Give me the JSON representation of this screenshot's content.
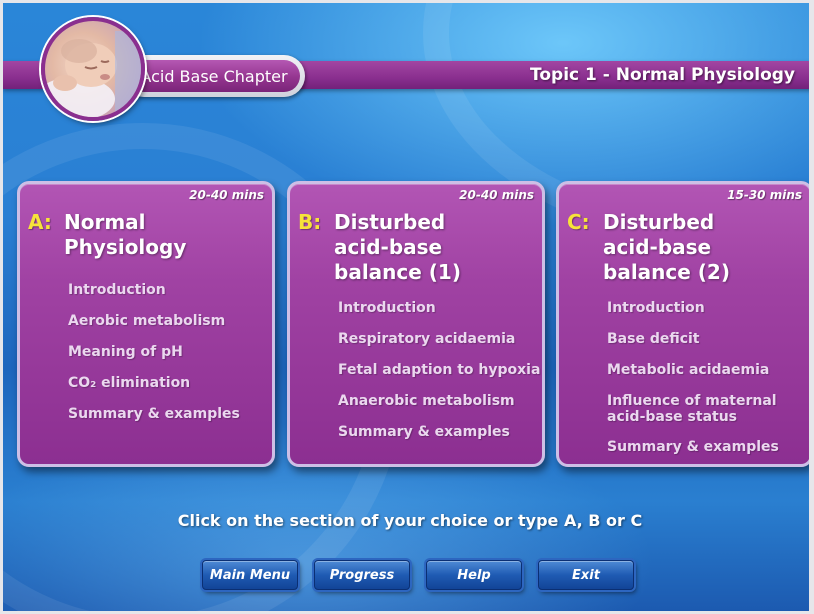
{
  "header": {
    "chapter_label": "Acid Base Chapter",
    "topic_title": "Topic 1 - Normal Physiology"
  },
  "cards": [
    {
      "letter": "A:",
      "title_line1": "Normal",
      "title_line2": "Physiology",
      "title_line3": "",
      "duration": "20-40 mins",
      "items": [
        "Introduction",
        "Aerobic metabolism",
        "Meaning of pH",
        "CO₂ elimination",
        "Summary & examples"
      ]
    },
    {
      "letter": "B:",
      "title_line1": "Disturbed",
      "title_line2": "acid-base",
      "title_line3": "balance (1)",
      "duration": "20-40 mins",
      "items": [
        "Introduction",
        "Respiratory acidaemia",
        "Fetal adaption to hypoxia",
        "Anaerobic metabolism",
        "Summary & examples"
      ]
    },
    {
      "letter": "C:",
      "title_line1": "Disturbed",
      "title_line2": "acid-base",
      "title_line3": "balance (2)",
      "duration": "15-30 mins",
      "items": [
        "Introduction",
        "Base deficit",
        "Metabolic acidaemia",
        "Influence of maternal acid-base status",
        "Summary & examples"
      ]
    }
  ],
  "instruction": "Click on the section of your choice or type A, B or C",
  "nav": {
    "main_menu": "Main Menu",
    "progress": "Progress",
    "help": "Help",
    "exit": "Exit"
  },
  "colors": {
    "card_purple": "#a042a3",
    "letter_yellow": "#f7e33a",
    "button_blue": "#1f5bb3",
    "background_blue": "#2a7fd3"
  },
  "icons": {
    "logo": "baby-photo-icon"
  }
}
